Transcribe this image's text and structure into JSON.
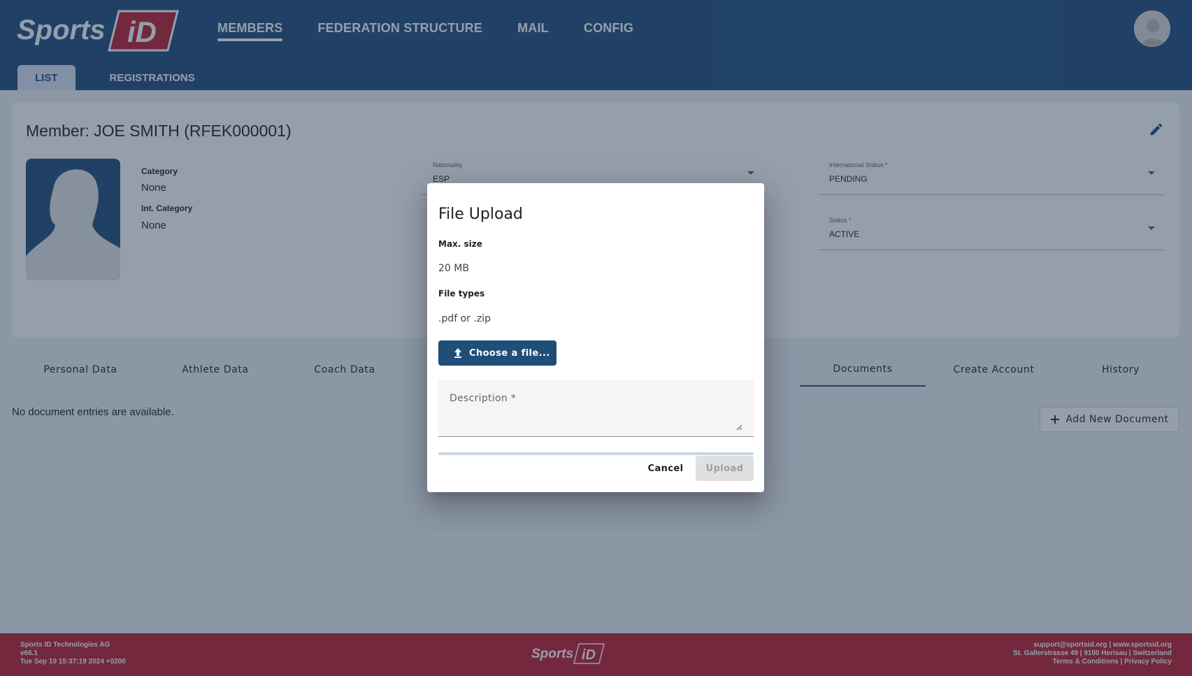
{
  "header": {
    "nav": [
      {
        "label": "MEMBERS",
        "active": true
      },
      {
        "label": "FEDERATION STRUCTURE",
        "active": false
      },
      {
        "label": "MAIL",
        "active": false
      },
      {
        "label": "CONFIG",
        "active": false
      }
    ],
    "subtabs": [
      {
        "label": "LIST",
        "active": true
      },
      {
        "label": "REGISTRATIONS",
        "active": false
      }
    ]
  },
  "member": {
    "title": "Member: JOE SMITH (RFEK000001)",
    "category_label": "Category",
    "category_value": "None",
    "int_category_label": "Int. Category",
    "int_category_value": "None",
    "nationality_label": "Nationality",
    "nationality_value": "ESP",
    "intl_status_label": "International Status *",
    "intl_status_value": "PENDING",
    "status_label": "Status *",
    "status_value": "ACTIVE"
  },
  "detail_tabs": [
    {
      "label": "Personal Data",
      "active": false
    },
    {
      "label": "Athlete Data",
      "active": false
    },
    {
      "label": "Coach Data",
      "active": false
    },
    {
      "label": "Documents",
      "active": true
    },
    {
      "label": "Create Account",
      "active": false
    },
    {
      "label": "History",
      "active": false
    }
  ],
  "documents": {
    "empty_text": "No document entries are available.",
    "add_button": "Add New Document"
  },
  "dialog": {
    "title": "File Upload",
    "max_size_label": "Max. size",
    "max_size_value": "20 MB",
    "file_types_label": "File types",
    "file_types_value": ".pdf or .zip",
    "choose_button": "Choose a file...",
    "description_label": "Description *",
    "progress": 0,
    "cancel_label": "Cancel",
    "upload_label": "Upload"
  },
  "footer": {
    "company": "Sports ID Technologies AG",
    "version": "v66.1",
    "timestamp": "Tue Sep 10 15:37:19 2024 +0200",
    "contact": "support@sportsid.org | www.sportsid.org",
    "address": "St. Gallerstrasse 49 | 9100 Herisau | Switzerland",
    "legal": "Terms & Conditions | Privacy Policy"
  },
  "colors": {
    "primary": "#1f4e79",
    "footer": "#bf1e2e"
  },
  "icons": [
    "sportsid-logo",
    "user-avatar-icon",
    "pencil-icon",
    "person-silhouette",
    "upload-icon",
    "plus-icon",
    "resize-handle-icon"
  ]
}
